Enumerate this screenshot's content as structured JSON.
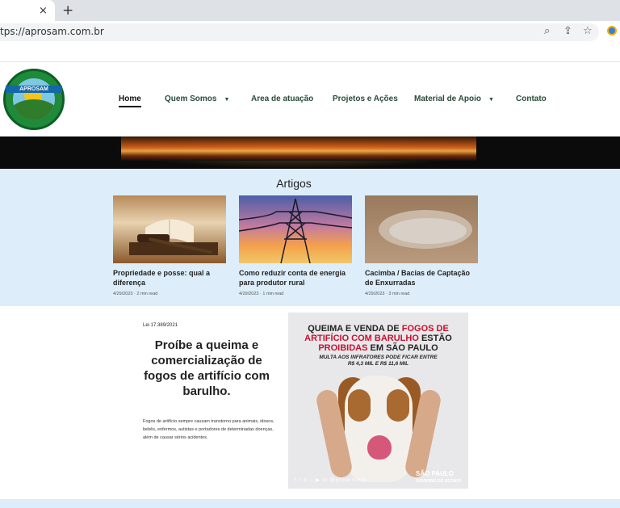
{
  "browser": {
    "url": "tps://aprosam.com.br",
    "tab_close": "×",
    "new_tab": "+"
  },
  "site": {
    "logo_text": "APROSAM",
    "nav": [
      {
        "label": "Home"
      },
      {
        "label": "Quem Somos"
      },
      {
        "label": "Area de atuação"
      },
      {
        "label": "Projetos e Ações"
      },
      {
        "label": "Material de Apoio"
      },
      {
        "label": "Contato"
      }
    ]
  },
  "articles": {
    "heading": "Artigos",
    "items": [
      {
        "title": "Propriedade e posse: qual a diferença",
        "meta": "4/29/2023 · 2 min read"
      },
      {
        "title": "Como reduzir conta de energia para produtor rural",
        "meta": "4/29/2023 · 1 min read"
      },
      {
        "title": "Cacimba / Bacias de Captação de Enxurradas",
        "meta": "4/29/2023 · 3 min read"
      }
    ]
  },
  "feature": {
    "law": "Lei 17.389/2021",
    "headline": "Proíbe a queima e comercialização de fogos de artifício com barulho.",
    "description": "Fogos de artifício sempre causam transtorno para animais, idosos, bebês, enfermos, autistas e portadores de determinadas doenças, além de causar sérios acidentes."
  },
  "poster": {
    "line1": "QUEIMA E VENDA DE",
    "line1_strong": "FOGOS DE",
    "line2": "ARTIFÍCIO COM BARULHO",
    "line2_tail": "ESTÃO",
    "line3_red": "PROIBIDAS",
    "line3_tail": "EM SÃO PAULO",
    "sub1": "MULTA AOS INFRATORES PODE FICAR ENTRE",
    "sub2": "R$ 4,3 MIL E R$ 11,6 MIL",
    "social": "f t ◎ ♪ ▶ in @governosp",
    "gov_logo_1": "SÃO PAULO",
    "gov_logo_2": "GOVERNO DO ESTADO"
  }
}
